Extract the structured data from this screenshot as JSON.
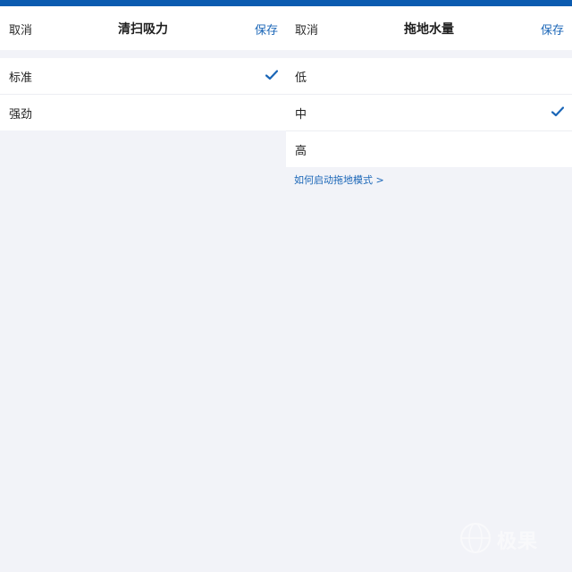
{
  "colors": {
    "accent": "#1a66b7",
    "top_bar": "#0b5bb0",
    "background": "#f2f3f8"
  },
  "left_panel": {
    "cancel_label": "取消",
    "title": "清扫吸力",
    "save_label": "保存",
    "options": [
      {
        "label": "标准",
        "selected": true
      },
      {
        "label": "强劲",
        "selected": false
      }
    ]
  },
  "right_panel": {
    "cancel_label": "取消",
    "title": "拖地水量",
    "save_label": "保存",
    "options": [
      {
        "label": "低",
        "selected": false
      },
      {
        "label": "中",
        "selected": true
      },
      {
        "label": "高",
        "selected": false
      }
    ],
    "help_link": "如何启动拖地模式 >"
  },
  "watermark": {
    "text": "极果",
    "icon": "globe-logo-icon"
  }
}
